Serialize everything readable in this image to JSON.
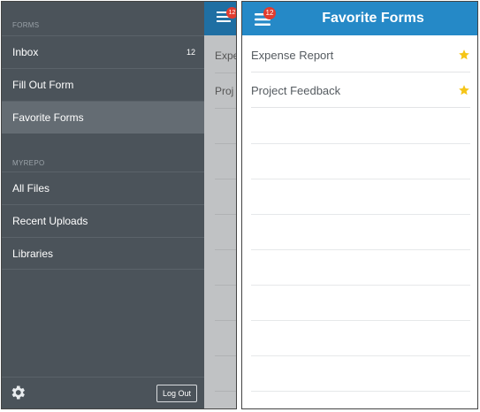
{
  "left_panel": {
    "section_forms": "FORMS",
    "forms_items": [
      {
        "label": "Inbox",
        "count": "12"
      },
      {
        "label": "Fill Out Form"
      },
      {
        "label": "Favorite Forms"
      }
    ],
    "section_myrepo": "MYREPO",
    "myrepo_items": [
      {
        "label": "All Files"
      },
      {
        "label": "Recent Uploads"
      },
      {
        "label": "Libraries"
      }
    ],
    "footer": {
      "settings_icon": "gear-icon",
      "logout_label": "Log Out"
    },
    "peek": {
      "badge": "12",
      "row1": "Expe",
      "row2": "Proj"
    }
  },
  "right_panel": {
    "header": {
      "title": "Favorite Forms",
      "menu_icon": "hamburger-icon",
      "badge": "12"
    },
    "favorites": [
      {
        "label": "Expense Report",
        "icon": "star-icon"
      },
      {
        "label": "Project Feedback",
        "icon": "star-icon"
      }
    ]
  },
  "colors": {
    "drawer_bg": "#4b535a",
    "drawer_active": "#646c73",
    "header_blue": "#2589c7",
    "badge_red": "#e23c2f",
    "star_yellow": "#f5c518"
  }
}
